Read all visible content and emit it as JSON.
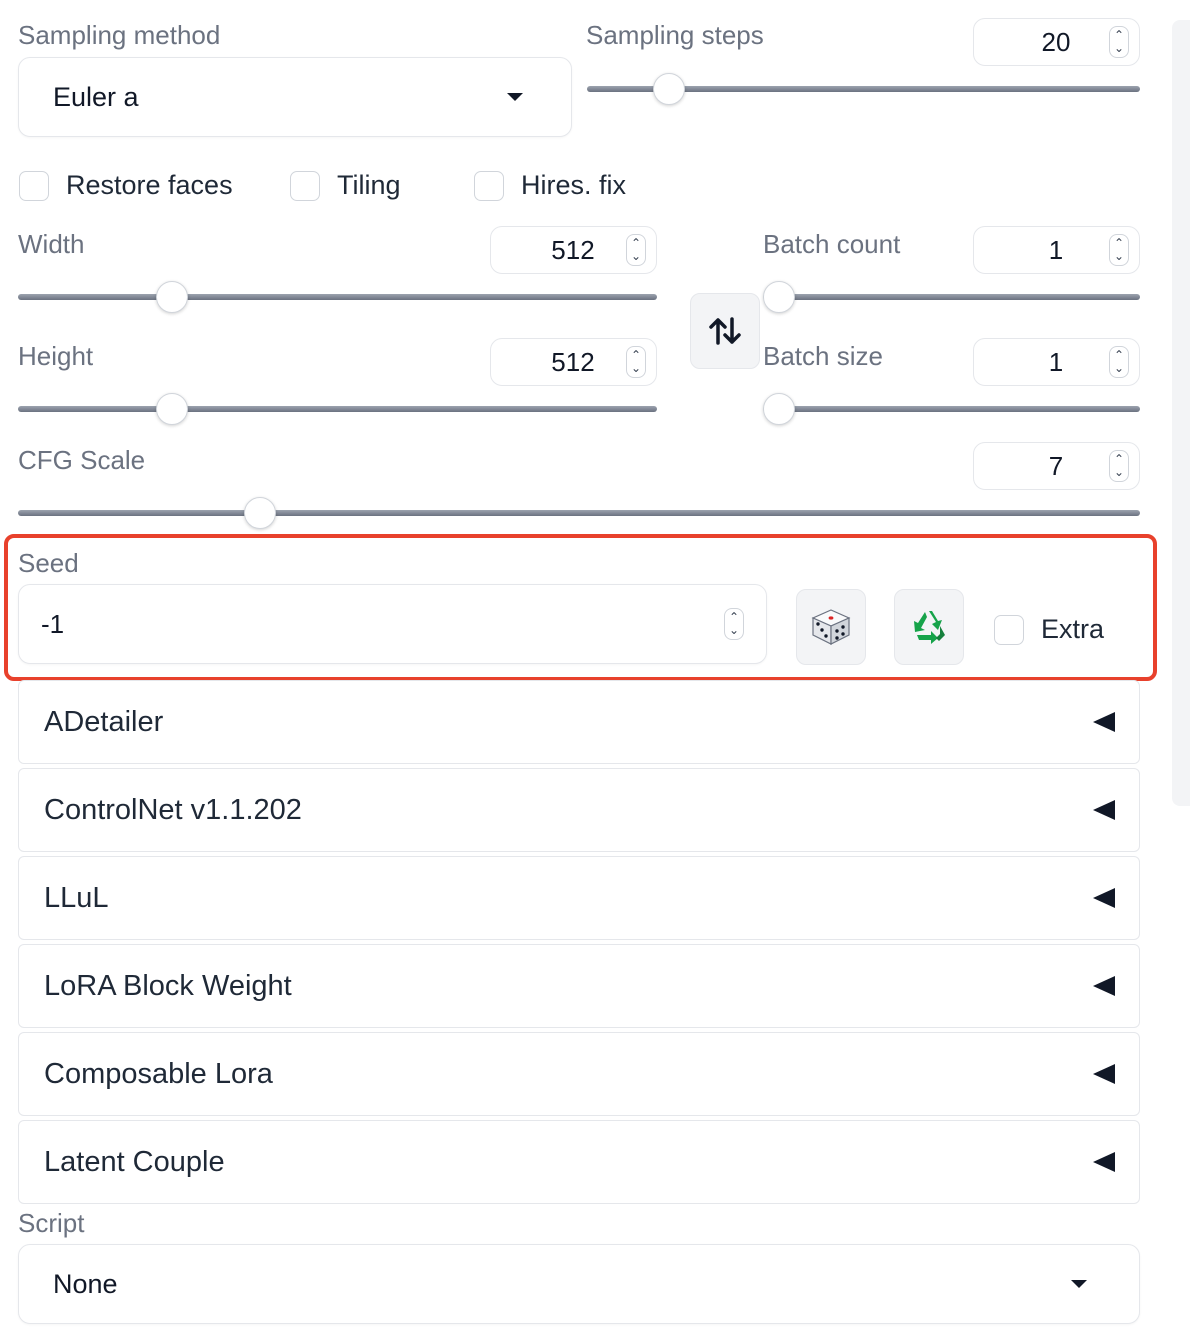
{
  "sampling_method": {
    "label": "Sampling method",
    "value": "Euler a"
  },
  "sampling_steps": {
    "label": "Sampling steps",
    "value": "20",
    "min": 1,
    "max": 150
  },
  "checkboxes": {
    "restore_faces": {
      "label": "Restore faces",
      "checked": false
    },
    "tiling": {
      "label": "Tiling",
      "checked": false
    },
    "hires_fix": {
      "label": "Hires. fix",
      "checked": false
    }
  },
  "width": {
    "label": "Width",
    "value": "512"
  },
  "height": {
    "label": "Height",
    "value": "512"
  },
  "swap_icon": "swap-arrows-icon",
  "batch_count": {
    "label": "Batch count",
    "value": "1"
  },
  "batch_size": {
    "label": "Batch size",
    "value": "1"
  },
  "cfg_scale": {
    "label": "CFG Scale",
    "value": "7"
  },
  "seed": {
    "label": "Seed",
    "value": "-1",
    "random_icon": "dice-icon",
    "reuse_icon": "recycle-icon",
    "extra_label": "Extra",
    "highlight_color": "#e8412c"
  },
  "accordions": [
    "ADetailer",
    "ControlNet v1.1.202",
    "LLuL",
    "LoRA Block Weight",
    "Composable Lora",
    "Latent Couple"
  ],
  "script": {
    "label": "Script",
    "value": "None"
  }
}
